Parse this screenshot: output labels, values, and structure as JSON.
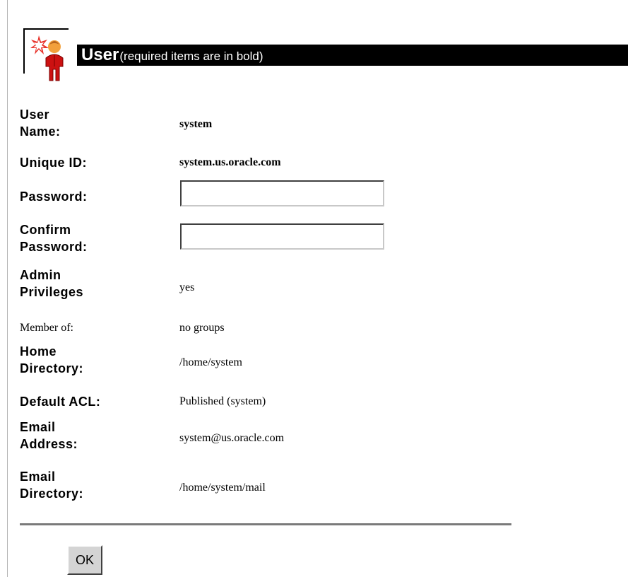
{
  "header": {
    "title": "User",
    "subtitle": "(required items are in bold)",
    "icon": "user-person-icon"
  },
  "fields": {
    "user_name": {
      "label_line1": "User",
      "label_line2": "Name:",
      "value": "system"
    },
    "unique_id": {
      "label": "Unique ID:",
      "value": "system.us.oracle.com"
    },
    "password": {
      "label": "Password:",
      "value": ""
    },
    "confirm_password": {
      "label_line1": "Confirm",
      "label_line2": "Password:",
      "value": ""
    },
    "admin_privileges": {
      "label_line1": "Admin",
      "label_line2": "Privileges",
      "value": "yes"
    },
    "member_of": {
      "label": "Member of:",
      "value": "no groups"
    },
    "home_directory": {
      "label_line1": "Home",
      "label_line2": "Directory:",
      "value": "/home/system"
    },
    "default_acl": {
      "label": "Default ACL:",
      "value": "Published (system)"
    },
    "email_address": {
      "label_line1": "Email",
      "label_line2": "Address:",
      "value": "system@us.oracle.com"
    },
    "email_directory": {
      "label_line1": "Email",
      "label_line2": "Directory:",
      "value": "/home/system/mail"
    }
  },
  "buttons": {
    "ok_label": "OK"
  },
  "colors": {
    "header_bar": "#000000",
    "header_text": "#ffffff",
    "icon_red": "#cc0000",
    "icon_skin": "#f2a03c",
    "button_face": "#d4d4d4"
  }
}
